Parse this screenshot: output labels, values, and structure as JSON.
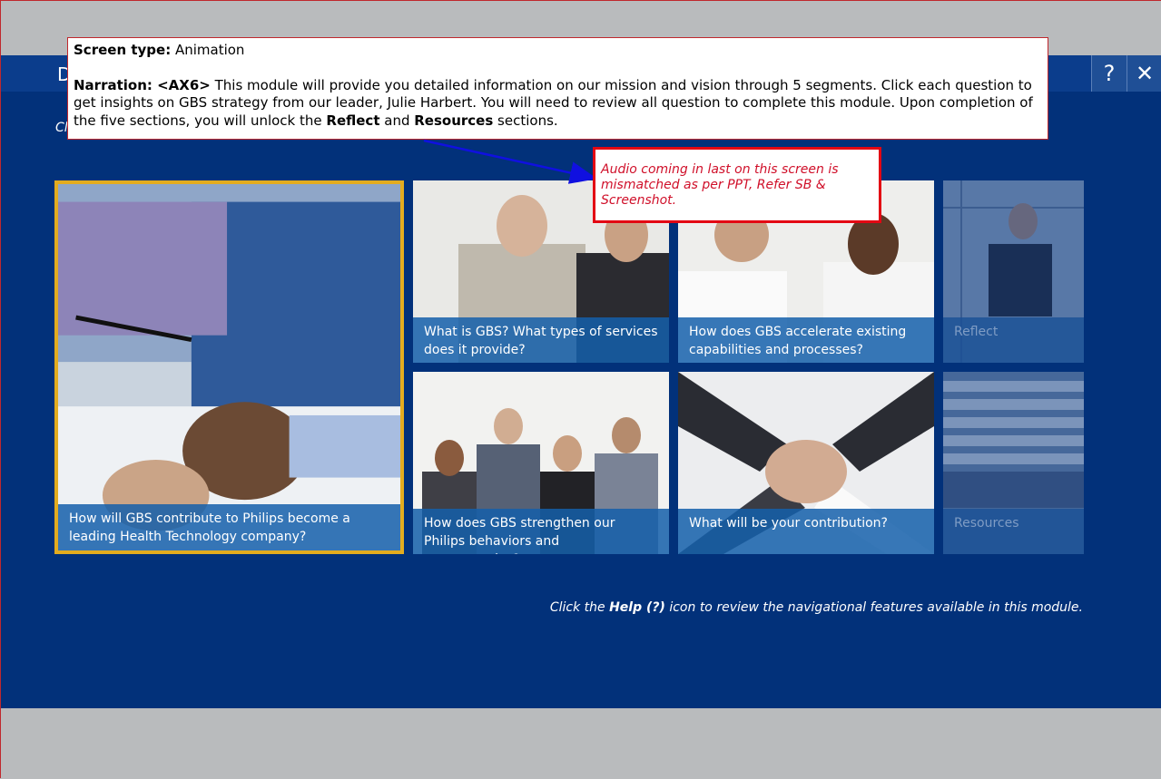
{
  "window": {
    "title_fragment": "D",
    "subtitle_fragment": "Cl",
    "help_label": "?",
    "close_label": "✕"
  },
  "tiles": [
    {
      "label": "How will GBS contribute to Philips become a leading Health Technology company?",
      "state": "selected"
    },
    {
      "label": "What is GBS? What types of services does it provide?",
      "state": "available"
    },
    {
      "label": "How does GBS accelerate existing capabilities and processes?",
      "state": "available"
    },
    {
      "label": "Reflect",
      "state": "locked"
    },
    {
      "label": "How does GBS strengthen our Philips behaviors and competencies?",
      "state": "available"
    },
    {
      "label": "What will be your contribution?",
      "state": "available"
    },
    {
      "label": "Resources",
      "state": "locked"
    }
  ],
  "help_note": {
    "prefix": "Click the ",
    "bold": "Help (?)",
    "suffix": " icon to review the navigational features available in this module."
  },
  "annotation": {
    "screen_type_label": "Screen type:",
    "screen_type_value": " Animation",
    "narration_label": "Narration: <AX6>",
    "narration_text_1": " This module will provide you detailed information on our mission and vision through 5 segments. Click each question to get insights on GBS strategy from our leader, Julie Harbert. You will need to review all question to complete this module. Upon completion of the five sections, you will unlock the ",
    "reflect_word": "Reflect",
    "and_word": " and ",
    "resources_word": "Resources",
    "narration_text_2": " sections."
  },
  "callout": {
    "text": "Audio coming in last on this screen is mismatched as per PPT, Refer SB & Screenshot."
  },
  "colors": {
    "stage": "#02317a",
    "selection_border": "#e3ac1f",
    "callout_border": "#e30613",
    "arrow": "#1010e0"
  }
}
